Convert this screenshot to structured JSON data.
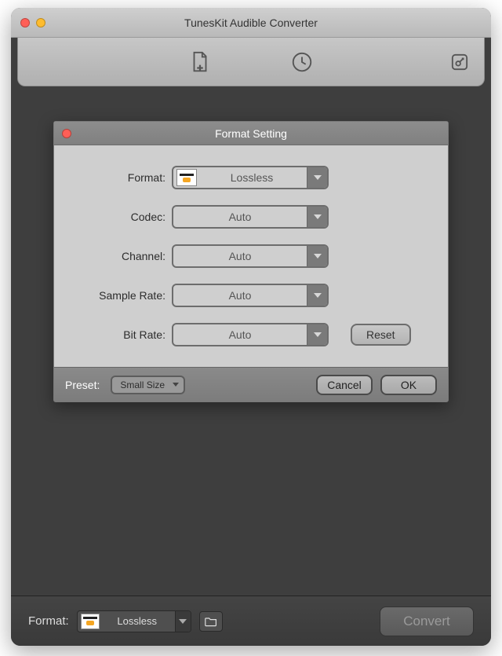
{
  "window": {
    "title": "TunesKit Audible Converter"
  },
  "modal": {
    "title": "Format Setting",
    "fields": {
      "format": {
        "label": "Format:",
        "value": "Lossless"
      },
      "codec": {
        "label": "Codec:",
        "value": "Auto"
      },
      "channel": {
        "label": "Channel:",
        "value": "Auto"
      },
      "sampleRate": {
        "label": "Sample Rate:",
        "value": "Auto"
      },
      "bitRate": {
        "label": "Bit Rate:",
        "value": "Auto"
      }
    },
    "buttons": {
      "reset": "Reset",
      "cancel": "Cancel",
      "ok": "OK"
    },
    "preset": {
      "label": "Preset:",
      "value": "Small Size"
    }
  },
  "bottomBar": {
    "formatLabel": "Format:",
    "formatValue": "Lossless",
    "convert": "Convert"
  }
}
